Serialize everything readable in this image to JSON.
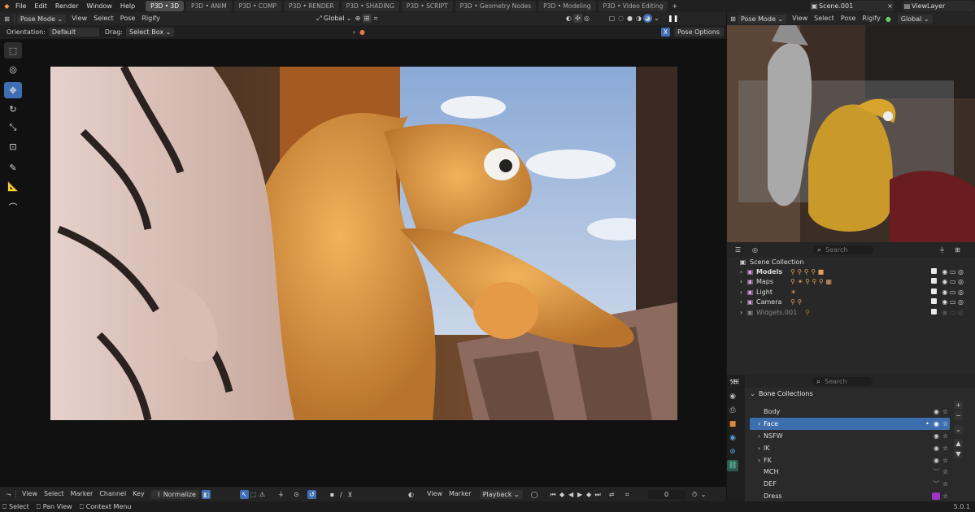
{
  "topbar": {
    "menus": [
      "File",
      "Edit",
      "Render",
      "Window",
      "Help"
    ],
    "workspaces": [
      "P3D • 3D",
      "P3D • ANIM",
      "P3D • COMP",
      "P3D • RENDER",
      "P3D • SHADING",
      "P3D • SCRIPT",
      "P3D • Geometry Nodes",
      "P3D • Modeling",
      "P3D • Video Editing"
    ],
    "scene": "Scene.001",
    "view_layer": "ViewLayer"
  },
  "viewport_header": {
    "mode": "Pose Mode",
    "menus": [
      "View",
      "Select",
      "Pose",
      "Rigify"
    ],
    "transform_orientation": "Global"
  },
  "tool_settings": {
    "orientation_label": "Orientation:",
    "orientation_value": "Default",
    "drag_label": "Drag:",
    "drag_value": "Select Box",
    "x_label": "X",
    "pose_options": "Pose Options"
  },
  "thumb_header": {
    "mode": "Pose Mode",
    "menus": [
      "View",
      "Select",
      "Pose",
      "Rigify"
    ],
    "transform_orientation": "Global"
  },
  "outliner": {
    "search_placeholder": "Search",
    "root": "Scene Collection",
    "rows": [
      {
        "label": "Models"
      },
      {
        "label": "Maps"
      },
      {
        "label": "Light"
      },
      {
        "label": "Camera"
      },
      {
        "label": "Widgets.001"
      }
    ]
  },
  "bone_panel": {
    "search_placeholder": "Search",
    "title": "Bone Collections",
    "rows": [
      {
        "label": "Body"
      },
      {
        "label": "Face"
      },
      {
        "label": "NSFW"
      },
      {
        "label": "IK"
      },
      {
        "label": "FK"
      },
      {
        "label": "MCH"
      },
      {
        "label": "DEF"
      },
      {
        "label": "Dress"
      }
    ]
  },
  "timeline": {
    "menus": [
      "View",
      "Select",
      "Marker",
      "Channel",
      "Key"
    ],
    "normalize": "Normalize",
    "right_menus": [
      "View",
      "Marker"
    ],
    "playback": "Playback",
    "frame": "0"
  },
  "status": {
    "select": "Select",
    "pan": "Pan View",
    "context": "Context Menu",
    "version": "5.0.1"
  },
  "colors": {
    "accent": "#3f6eb3",
    "selected_row": "#3d6ead",
    "dress_swatch": "#a233c9"
  }
}
